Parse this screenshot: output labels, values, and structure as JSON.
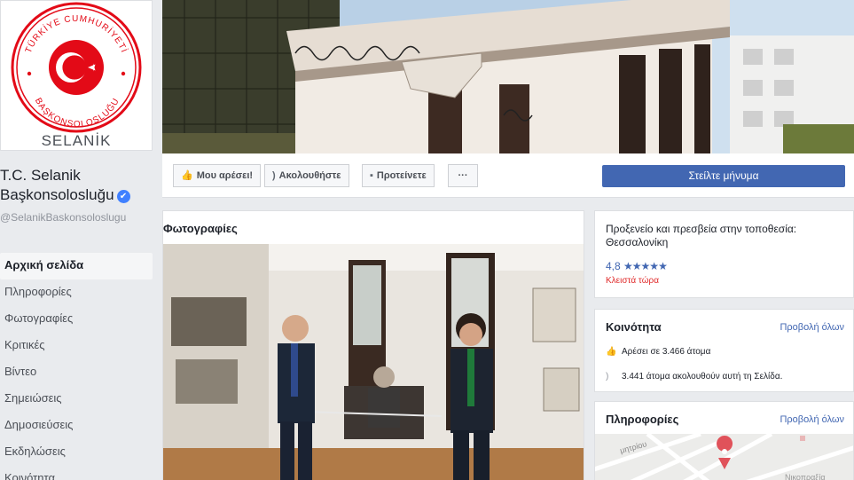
{
  "profile": {
    "seal_top_text": "TÜRKİYE CUMHURİYETİ",
    "seal_bottom_text": "BAŞKONSOLOSLUĞU",
    "seal_caption": "SELANİK",
    "name": "T.C. Selanik Başkonsolosluğu",
    "handle": "@SelanikBaskonsoloslugu"
  },
  "nav": [
    {
      "label": "Αρχική σελίδα",
      "active": true
    },
    {
      "label": "Πληροφορίες"
    },
    {
      "label": "Φωτογραφίες"
    },
    {
      "label": "Κριτικές"
    },
    {
      "label": "Βίντεο"
    },
    {
      "label": "Σημειώσεις"
    },
    {
      "label": "Δημοσιεύσεις"
    },
    {
      "label": "Εκδηλώσεις"
    },
    {
      "label": "Κοινότητα"
    }
  ],
  "actions": {
    "like": "Μου αρέσει!",
    "follow": "Ακολουθήστε",
    "suggest": "Προτείνετε",
    "more": "···",
    "send_message": "Στείλτε μήνυμα"
  },
  "photos": {
    "title": "Φωτογραφίες"
  },
  "category": {
    "text": "Προξενείο και πρεσβεία στην τοποθεσία: Θεσσαλονίκη",
    "rating": "4,8",
    "stars": "★★★★★",
    "status": "Κλειστά τώρα"
  },
  "community": {
    "title": "Κοινότητα",
    "see_all": "Προβολή όλων",
    "likes": "Αρέσει σε 3.466 άτομα",
    "follows": "3.441 άτομα ακολουθούν αυτή τη Σελίδα."
  },
  "about": {
    "title": "Πληροφορίες",
    "see_all": "Προβολή όλων",
    "map_street": "μητρίου",
    "map_area": "Νικοπραξία"
  },
  "colors": {
    "accent": "#4267b2",
    "flag_red": "#e30a17",
    "closed_red": "#e02c2c"
  },
  "icons": {
    "like": "thumbs-up-icon",
    "follow": "rss-icon",
    "suggest": "speech-bubble-icon",
    "verified": "verified-check-icon",
    "map_pin": "map-pin-icon"
  }
}
